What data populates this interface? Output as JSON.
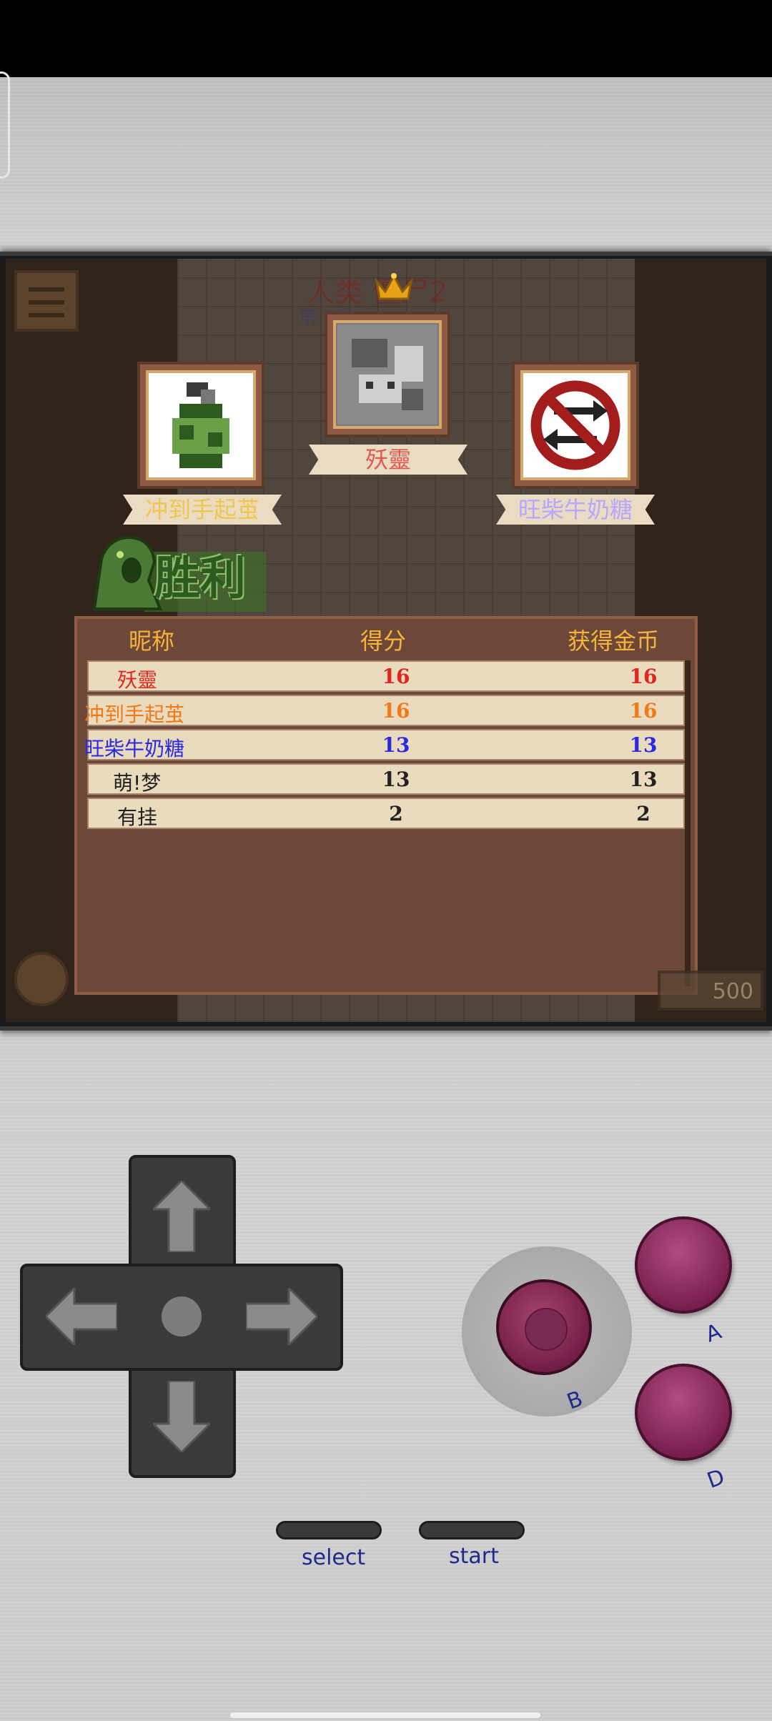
{
  "game": {
    "ghost_title": "人类 僵尸2",
    "ghost_subtitle": "第 5局",
    "coins": "500"
  },
  "podium": {
    "first": {
      "name": "殀靈"
    },
    "second": {
      "name": "冲到手起茧"
    },
    "third": {
      "name": "旺柴牛奶糖"
    }
  },
  "victory_label": "胜利",
  "table": {
    "headers": {
      "name": "昵称",
      "score": "得分",
      "gold": "获得金币"
    },
    "rows": [
      {
        "name": "殀靈",
        "score": "16",
        "gold": "16",
        "color": "#e0251d"
      },
      {
        "name": "冲到手起茧",
        "score": "16",
        "gold": "16",
        "color": "#f07a17"
      },
      {
        "name": "旺柴牛奶糖",
        "score": "13",
        "gold": "13",
        "color": "#2a2ae0"
      },
      {
        "name": "萌!梦",
        "score": "13",
        "gold": "13",
        "color": "#222222"
      },
      {
        "name": "有挂",
        "score": "2",
        "gold": "2",
        "color": "#222222"
      }
    ]
  },
  "controls": {
    "a_label": "A",
    "b_label": "B",
    "d_label": "D",
    "select_label": "select",
    "start_label": "start"
  }
}
